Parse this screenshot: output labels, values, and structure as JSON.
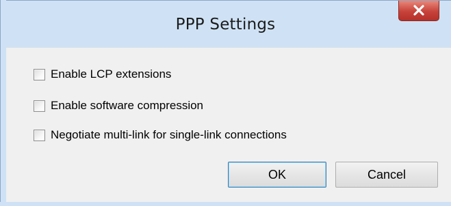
{
  "window": {
    "title": "PPP Settings",
    "close_icon": "close-icon",
    "close_color": "#c7423a"
  },
  "options": [
    {
      "label": "Enable LCP extensions",
      "checked": false
    },
    {
      "label": "Enable software compression",
      "checked": false
    },
    {
      "label": "Negotiate multi-link for single-link connections",
      "checked": false
    }
  ],
  "buttons": {
    "ok_label": "OK",
    "cancel_label": "Cancel"
  }
}
